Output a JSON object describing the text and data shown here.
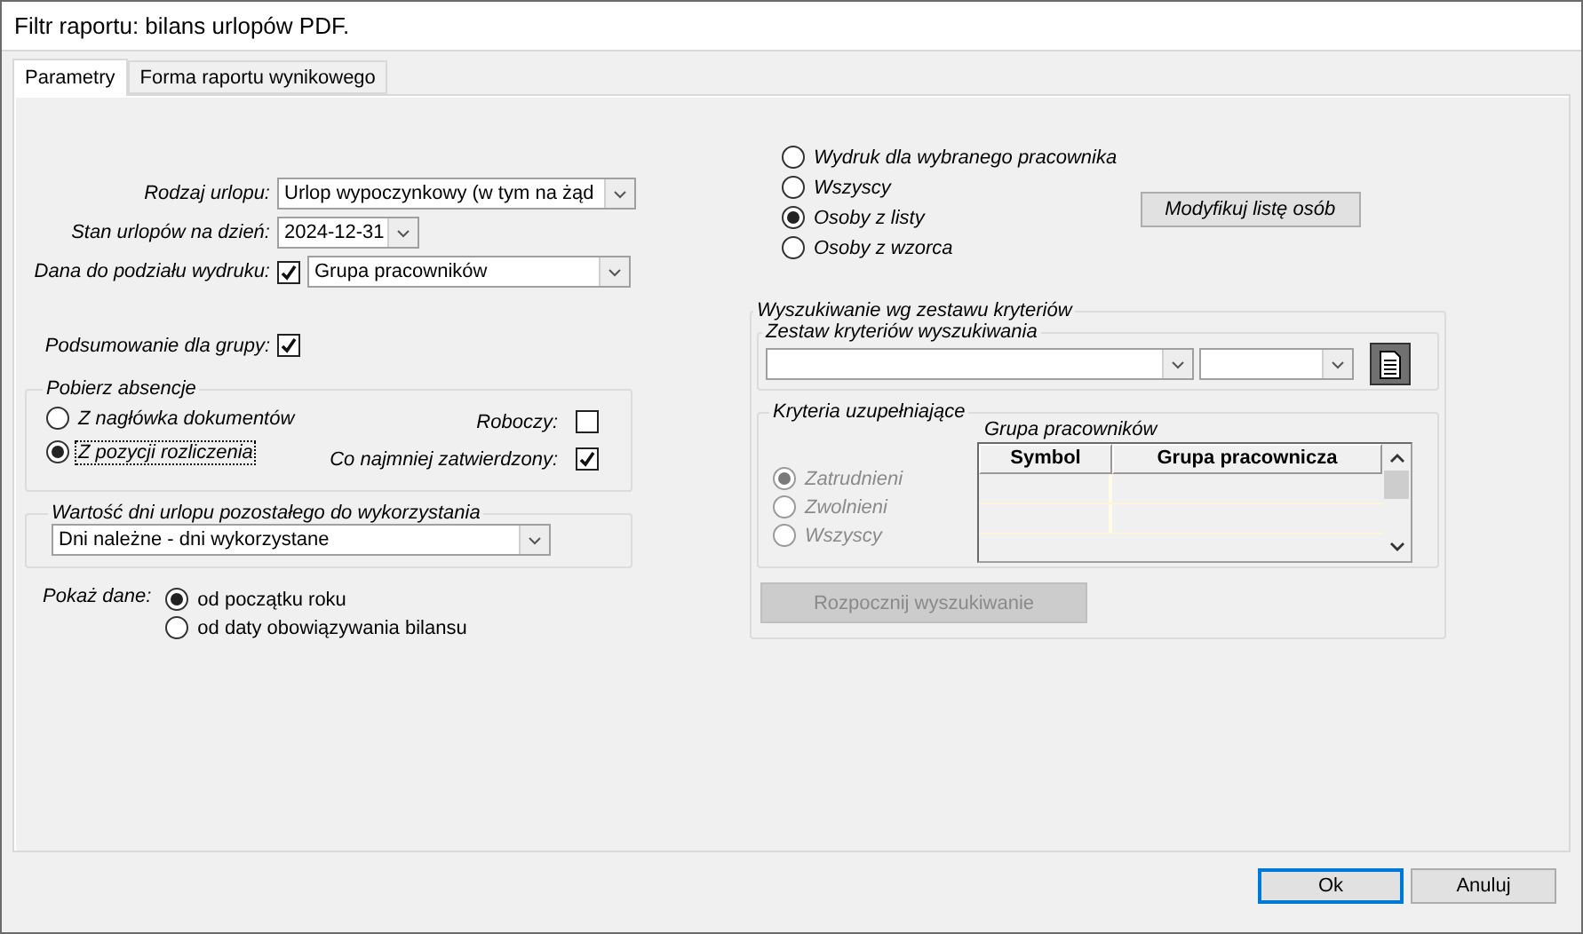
{
  "window": {
    "title": "Filtr raportu: bilans urlopów PDF."
  },
  "tabs": [
    {
      "label": "Parametry",
      "selected": true
    },
    {
      "label": "Forma raportu wynikowego",
      "selected": false
    }
  ],
  "report_fields": [
    {
      "kind": "select",
      "label": "Rodzaj urlopu:",
      "value": "Urlop wypoczynkowy (w tym na żąd"
    },
    {
      "kind": "date",
      "label": "Stan urlopów na dzień:",
      "value": "2024-12-31"
    },
    {
      "kind": "check_select",
      "label": "Dana do podziału wydruku:",
      "checked": true,
      "value": "Grupa pracowników"
    }
  ],
  "group_summary": {
    "label": "Podsumowanie dla grupy:",
    "checked": true
  },
  "absences": {
    "title": "Pobierz absencje",
    "sources": [
      {
        "label": "Z nagłówka dokumentów",
        "selected": false,
        "focused": false
      },
      {
        "label": "Z pozycji rozliczenia",
        "selected": true,
        "focused": true
      }
    ],
    "statuses": [
      {
        "label": "Roboczy:",
        "checked": false
      },
      {
        "label": "Co najmniej zatwierdzony:",
        "checked": true
      }
    ]
  },
  "remaining_value": {
    "title": "Wartość dni urlopu pozostałego do wykorzystania",
    "value": "Dni należne - dni wykorzystane"
  },
  "show_data": {
    "label": "Pokaż dane:",
    "options": [
      {
        "label": "od początku roku",
        "selected": true
      },
      {
        "label": "od daty obowiązywania bilansu",
        "selected": false
      }
    ]
  },
  "employee_scope": {
    "options": [
      {
        "label": "Wydruk dla wybranego pracownika",
        "selected": false
      },
      {
        "label": "Wszyscy",
        "selected": false
      },
      {
        "label": "Osoby z listy",
        "selected": true
      },
      {
        "label": "Osoby z wzorca",
        "selected": false
      }
    ],
    "modify_button": "Modyfikuj listę osób"
  },
  "criteria_search": {
    "title": "Wyszukiwanie wg zestawu kryteriów",
    "criteria_set": {
      "title": "Zestaw kryteriów wyszukiwania"
    },
    "supplementary": {
      "title": "Kryteria uzupełniające",
      "disabled": true,
      "options": [
        {
          "label": "Zatrudnieni",
          "selected": true
        },
        {
          "label": "Zwolnieni",
          "selected": false
        },
        {
          "label": "Wszyscy",
          "selected": false
        }
      ],
      "employee_group": {
        "title": "Grupa pracowników",
        "columns": [
          "Symbol",
          "Grupa pracownicza"
        ]
      }
    },
    "search_button": {
      "label": "Rozpocznij wyszukiwanie",
      "disabled": true
    }
  },
  "buttons": [
    {
      "label": "Ok",
      "default": true
    },
    {
      "label": "Anuluj",
      "default": false
    }
  ]
}
